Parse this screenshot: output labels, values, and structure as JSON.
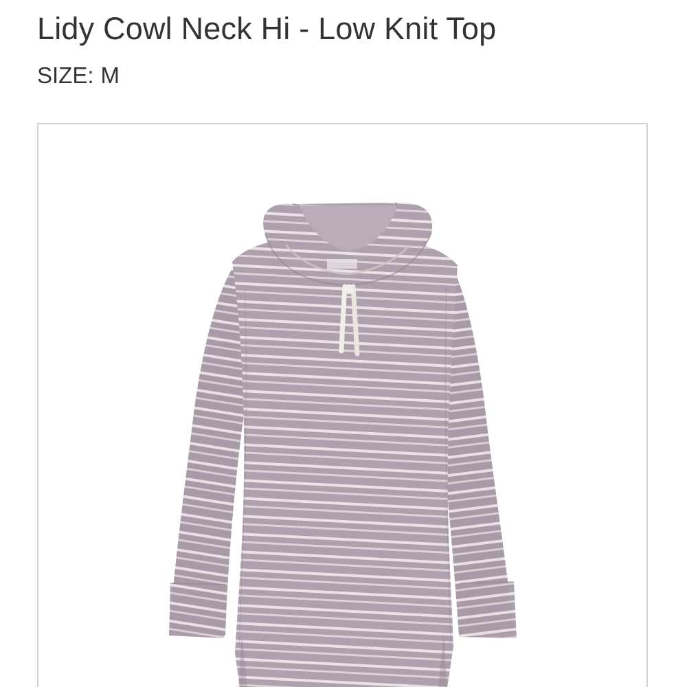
{
  "product": {
    "title": "Lidy Cowl Neck Hi - Low Knit Top",
    "size_label": "SIZE:",
    "size_value": "M"
  },
  "image": {
    "subject": "cowl-neck-striped-knit-top",
    "colors": {
      "knit_base": "#aea0ac",
      "knit_dark": "#9d8f9b",
      "stripe": "#e9e3e6",
      "drawstring": "#f2efe9",
      "frame_border": "#d2d2d2"
    }
  }
}
